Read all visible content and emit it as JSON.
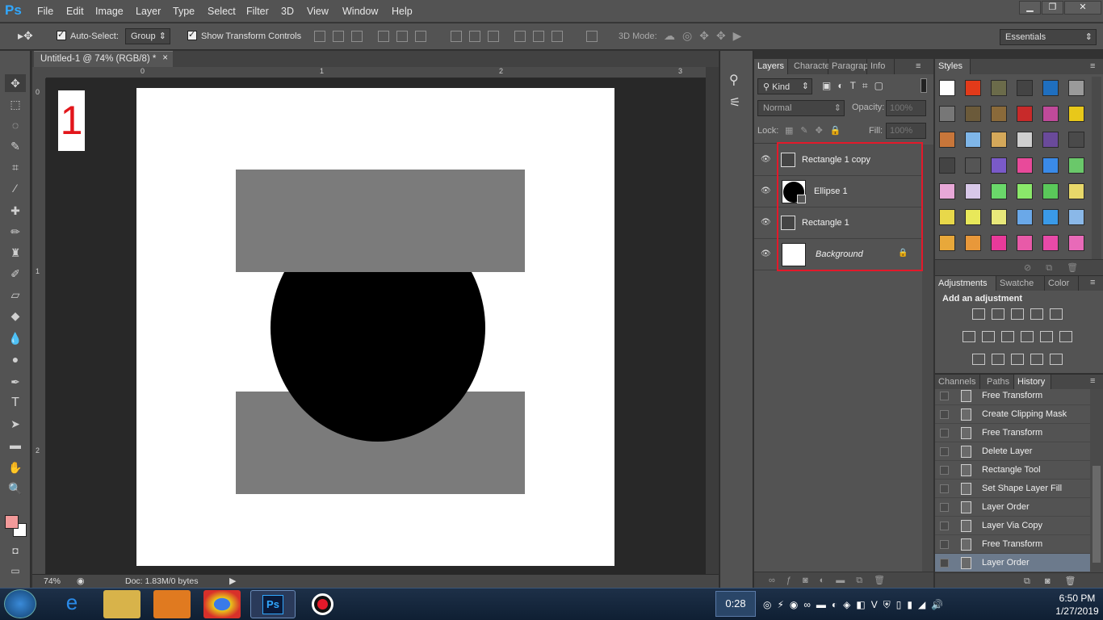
{
  "app": {
    "logo": "Ps"
  },
  "menubar": {
    "items": [
      "File",
      "Edit",
      "Image",
      "Layer",
      "Type",
      "Select",
      "Filter",
      "3D",
      "View",
      "Window",
      "Help"
    ]
  },
  "window_controls": {
    "minimize": "▁",
    "restore": "❐",
    "close": "✕"
  },
  "options": {
    "auto_select_label": "Auto-Select:",
    "auto_select_value": "Group",
    "show_transform_label": "Show Transform Controls",
    "mode_3d_label": "3D Mode:",
    "workspace": "Essentials"
  },
  "document": {
    "tab_title": "Untitled-1 @ 74% (RGB/8) *",
    "tab_close": "×",
    "ruler_h": [
      "0",
      "1",
      "2",
      "3"
    ],
    "ruler_v": [
      "0",
      "1",
      "2"
    ],
    "zoom": "74%",
    "doc_info": "Doc: 1.83M/0 bytes",
    "canvas_label": "1"
  },
  "layers_panel": {
    "tabs": [
      "Layers",
      "Characte",
      "Paragrap",
      "Info"
    ],
    "filter_kind": "Kind",
    "blend_mode": "Normal",
    "opacity_label": "Opacity:",
    "opacity_value": "100%",
    "lock_label": "Lock:",
    "fill_label": "Fill:",
    "fill_value": "100%",
    "layers": [
      {
        "name": "Rectangle 1 copy",
        "type": "shape"
      },
      {
        "name": "Ellipse 1",
        "type": "clipped"
      },
      {
        "name": "Rectangle 1",
        "type": "shape"
      },
      {
        "name": "Background",
        "type": "background"
      }
    ]
  },
  "styles_panel": {
    "tab": "Styles",
    "swatch_colors": [
      "#ffffff",
      "#e23a1a",
      "#6b6b4a",
      "#444444",
      "#1f6fbf",
      "#9a9a9a",
      "#777777",
      "#6b5a3a",
      "#8a6a3a",
      "#c82a2a",
      "#c04a9a",
      "#e8c81a",
      "#c8763a",
      "#7fb6e8",
      "#d4a85a",
      "#cfcfcf",
      "#6a4a9a",
      "#4a4a4a",
      "#444444",
      "#555555",
      "#7a5ac8",
      "#e84a9a",
      "#3a8ae8",
      "#6ac86a",
      "#e8a8d8",
      "#d8c8e8",
      "#6ad86a",
      "#8ae86a",
      "#5ac85a",
      "#e8d86a",
      "#e8d84a",
      "#e8e85a",
      "#e8e87a",
      "#6aa8e8",
      "#3a9ae8",
      "#8ab8e8",
      "#e8a83a",
      "#e8983a",
      "#e83a9a",
      "#e85aa8",
      "#e84aa8",
      "#e86ab8"
    ]
  },
  "adjustments_panel": {
    "tabs": [
      "Adjustments",
      "Swatche",
      "Color"
    ],
    "heading": "Add an adjustment"
  },
  "history_panel": {
    "tabs": [
      "Channels",
      "Paths",
      "History"
    ],
    "items": [
      "Free Transform",
      "Create Clipping Mask",
      "Free Transform",
      "Delete Layer",
      "Rectangle Tool",
      "Set Shape Layer Fill",
      "Layer Order",
      "Layer Via Copy",
      "Free Transform",
      "Layer Order"
    ]
  },
  "taskbar": {
    "timer": "0:28",
    "time": "6:50 PM",
    "date": "1/27/2019"
  },
  "colors": {
    "foreground": "#f29a9a",
    "background": "#ffffff",
    "highlight": "#e3192a",
    "shape_gray": "#7b7b7b",
    "ellipse": "#000000"
  }
}
